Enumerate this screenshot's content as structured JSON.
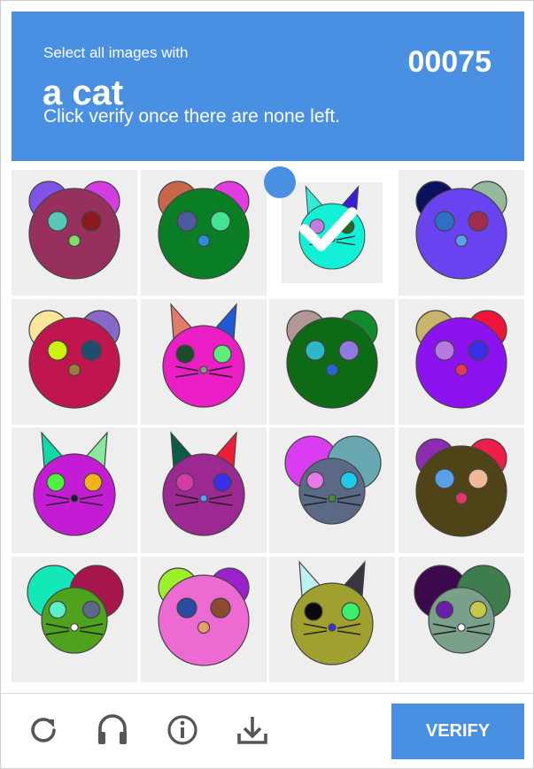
{
  "captcha": {
    "instruction_prefix": "Select all images with",
    "target_label": "a cat",
    "instruction_note": "Click verify once there are none left.",
    "counter": "00075"
  },
  "colors": {
    "accent": "#4a90e2",
    "tile_bg": "#eeeeee"
  },
  "tiles": [
    {
      "animal": "bear",
      "face": "#98305d",
      "ear_l": "#8152e8",
      "ear_r": "#d43be0",
      "eye_l": "#59c8b6",
      "eye_r": "#8b1a1e",
      "nose": "#7fdc6a",
      "selected": false
    },
    {
      "animal": "bear",
      "face": "#0a7e25",
      "ear_l": "#c9674a",
      "ear_r": "#e23bdf",
      "eye_l": "#4d5aa0",
      "eye_r": "#41e590",
      "nose": "#2d8de0",
      "selected": false
    },
    {
      "animal": "cat",
      "face": "#12f0d8",
      "ear_l": "#30ecd8",
      "ear_r": "#3422d0",
      "eye_l": "#c47be0",
      "eye_r": "#1f6a1f",
      "nose": "#c2558a",
      "selected": true
    },
    {
      "animal": "bear",
      "face": "#6a43f0",
      "ear_l": "#08125e",
      "ear_r": "#96b99e",
      "eye_l": "#2d70c4",
      "eye_r": "#a02d4e",
      "nose": "#5aa0f0",
      "selected": false
    },
    {
      "animal": "bear",
      "face": "#c0164f",
      "ear_l": "#fde69a",
      "ear_r": "#8668c6",
      "eye_l": "#cdf10e",
      "eye_r": "#1d4e70",
      "nose": "#9b7d3c",
      "selected": false
    },
    {
      "animal": "cat",
      "face": "#ea1ec4",
      "ear_l": "#e47a6a",
      "ear_r": "#1e5ad8",
      "eye_l": "#1e4a2e",
      "eye_r": "#5cf07a",
      "nose": "#8a9a8a",
      "selected": false
    },
    {
      "animal": "bear",
      "face": "#0d6b15",
      "ear_l": "#b39696",
      "ear_r": "#118b2e",
      "eye_l": "#2db6c8",
      "eye_r": "#8e7ae0",
      "nose": "#2466d8",
      "selected": false
    },
    {
      "animal": "bear",
      "face": "#8c12f0",
      "ear_l": "#c8b46c",
      "ear_r": "#f0143a",
      "eye_l": "#b67ae0",
      "eye_r": "#3a2ee8",
      "nose": "#e8365a",
      "selected": false
    },
    {
      "animal": "cat",
      "face": "#c41cd4",
      "ear_l": "#10d8a8",
      "ear_r": "#8ae89a",
      "eye_l": "#50f040",
      "eye_r": "#f0b41a",
      "nose": "#1a1a3a",
      "selected": false
    },
    {
      "animal": "cat",
      "face": "#9c2892",
      "ear_l": "#0e5a48",
      "ear_r": "#f01e34",
      "eye_l": "#d63aa4",
      "eye_r": "#3a2ee8",
      "nose": "#5aa0f0",
      "selected": false
    },
    {
      "animal": "mouse",
      "face": "#5a6a86",
      "ear_l": "#d83ef0",
      "ear_r": "#68a8b0",
      "eye_l": "#e87ae8",
      "eye_r": "#22c8e8",
      "nose": "#4a8a2e",
      "selected": false
    },
    {
      "animal": "bear",
      "face": "#4f4418",
      "ear_l": "#8c2cb0",
      "ear_r": "#ec1e4a",
      "eye_l": "#5aa0e8",
      "eye_r": "#f0b896",
      "nose": "#e4346a",
      "selected": false
    },
    {
      "animal": "mouse",
      "face": "#4ea21e",
      "ear_l": "#12e8b8",
      "ear_r": "#a6164a",
      "eye_l": "#5af0c8",
      "eye_r": "#5a6a86",
      "nose": "#ffffff",
      "selected": false
    },
    {
      "animal": "bear",
      "face": "#ec6ad2",
      "ear_l": "#9cf02a",
      "ear_r": "#9c20cc",
      "eye_l": "#284aa0",
      "eye_r": "#8c4a2e",
      "nose": "#e8a06a",
      "selected": false
    },
    {
      "animal": "cat",
      "face": "#a0a02e",
      "ear_l": "#bef0f0",
      "ear_r": "#3a3440",
      "eye_l": "#0a0a0a",
      "eye_r": "#3af06a",
      "nose": "#3a2ee8",
      "selected": false
    },
    {
      "animal": "mouse",
      "face": "#7aa08a",
      "ear_l": "#3c0a4c",
      "ear_r": "#3e7e4e",
      "eye_l": "#6a1eac",
      "eye_r": "#c8c84a",
      "nose": "#ffffff",
      "selected": false
    }
  ],
  "controls": {
    "reload_icon": "reload-icon",
    "audio_icon": "headphones-icon",
    "info_icon": "info-icon",
    "download_icon": "download-icon",
    "verify_label": "VERIFY"
  }
}
